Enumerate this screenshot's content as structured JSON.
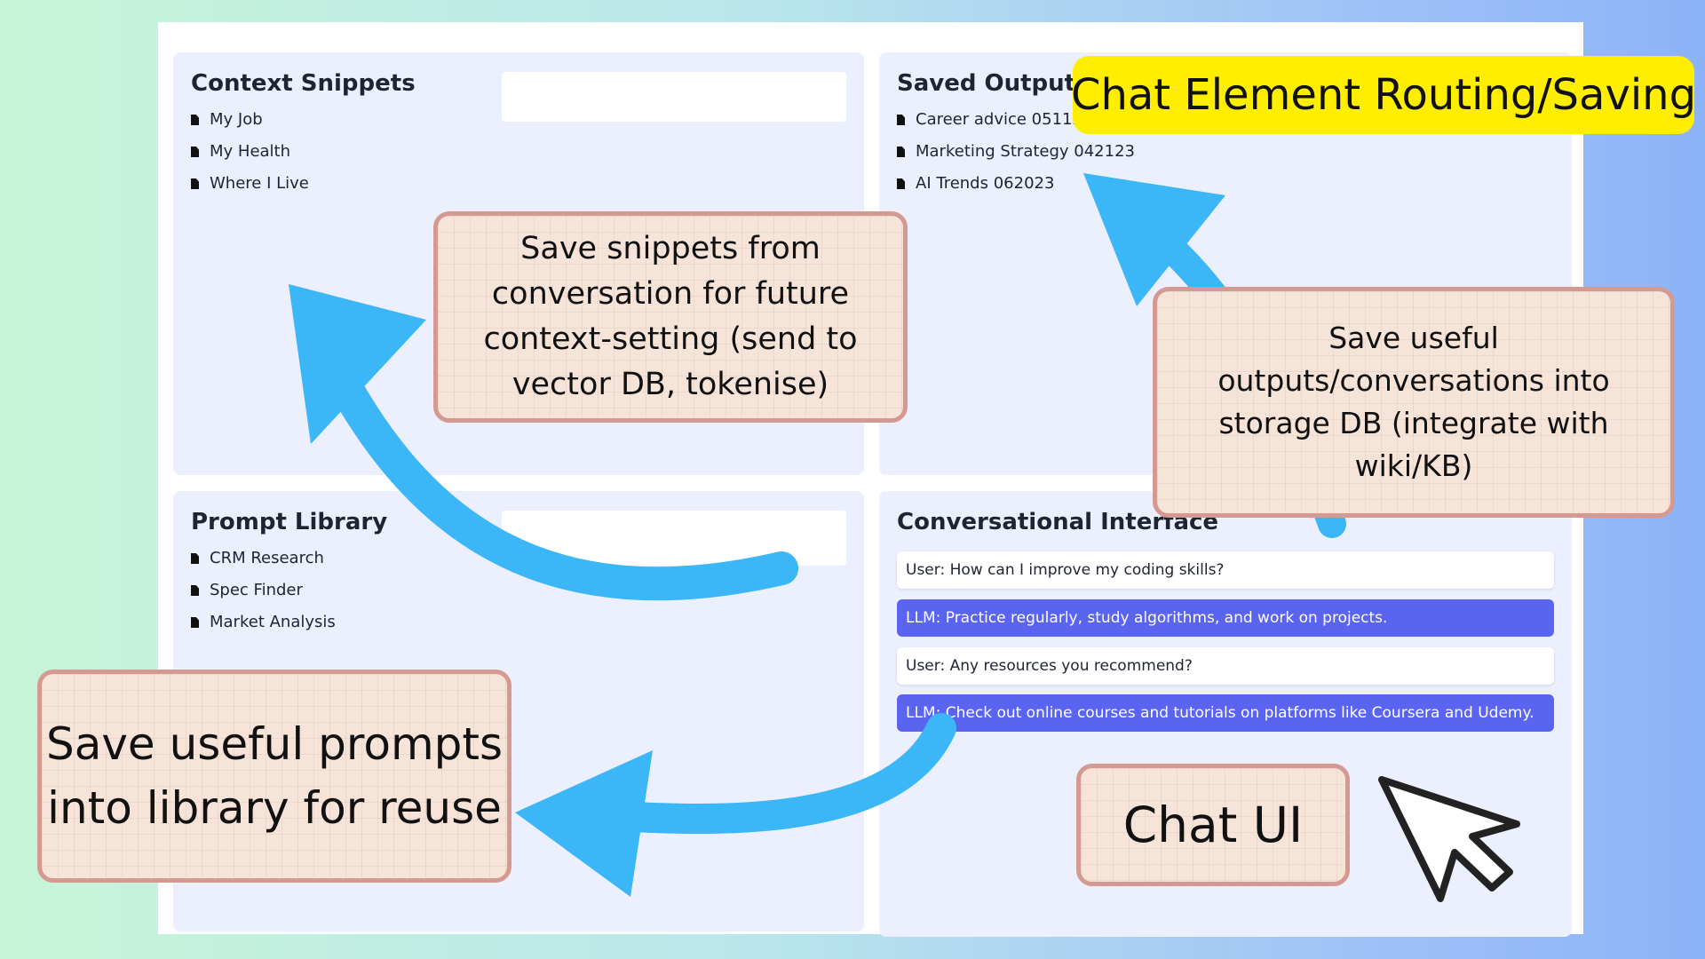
{
  "title": "Chat Element Routing/Saving",
  "panels": {
    "context": {
      "title": "Context Snippets",
      "items": [
        "My Job",
        "My Health",
        "Where I Live"
      ]
    },
    "saved": {
      "title": "Saved Outputs",
      "items": [
        "Career advice 05112",
        "Marketing Strategy 042123",
        "AI Trends 062023"
      ]
    },
    "prompts": {
      "title": "Prompt Library",
      "items": [
        "CRM Research",
        "Spec Finder",
        "Market Analysis"
      ]
    },
    "chat": {
      "title": "Conversational Interface",
      "messages": [
        "User: How can I improve my coding skills?",
        "LLM: Practice regularly, study algorithms, and work on projects.",
        "User: Any resources you recommend?",
        "LLM: Check out online courses and tutorials on platforms like Coursera and Udemy."
      ]
    }
  },
  "notes": {
    "snippets": [
      "Save snippets from",
      "conversation for future",
      "context-setting (send to",
      "vector DB, tokenise)"
    ],
    "outputs": [
      "Save useful",
      "outputs/conversations into",
      "storage DB (integrate with",
      "wiki/KB)"
    ],
    "prompts": [
      "Save useful prompts",
      "into library for reuse"
    ],
    "chat_ui": "Chat UI"
  },
  "colors": {
    "arrow": "#3bb6f7",
    "note_fill": "#f7e4d9",
    "note_border": "#d49a92",
    "title_badge": "#ffee00",
    "llm_bubble": "#5b64f0",
    "panel": "#eceffd"
  },
  "icons": [
    "document-icon",
    "cursor-icon",
    "curved-arrow-icon"
  ]
}
